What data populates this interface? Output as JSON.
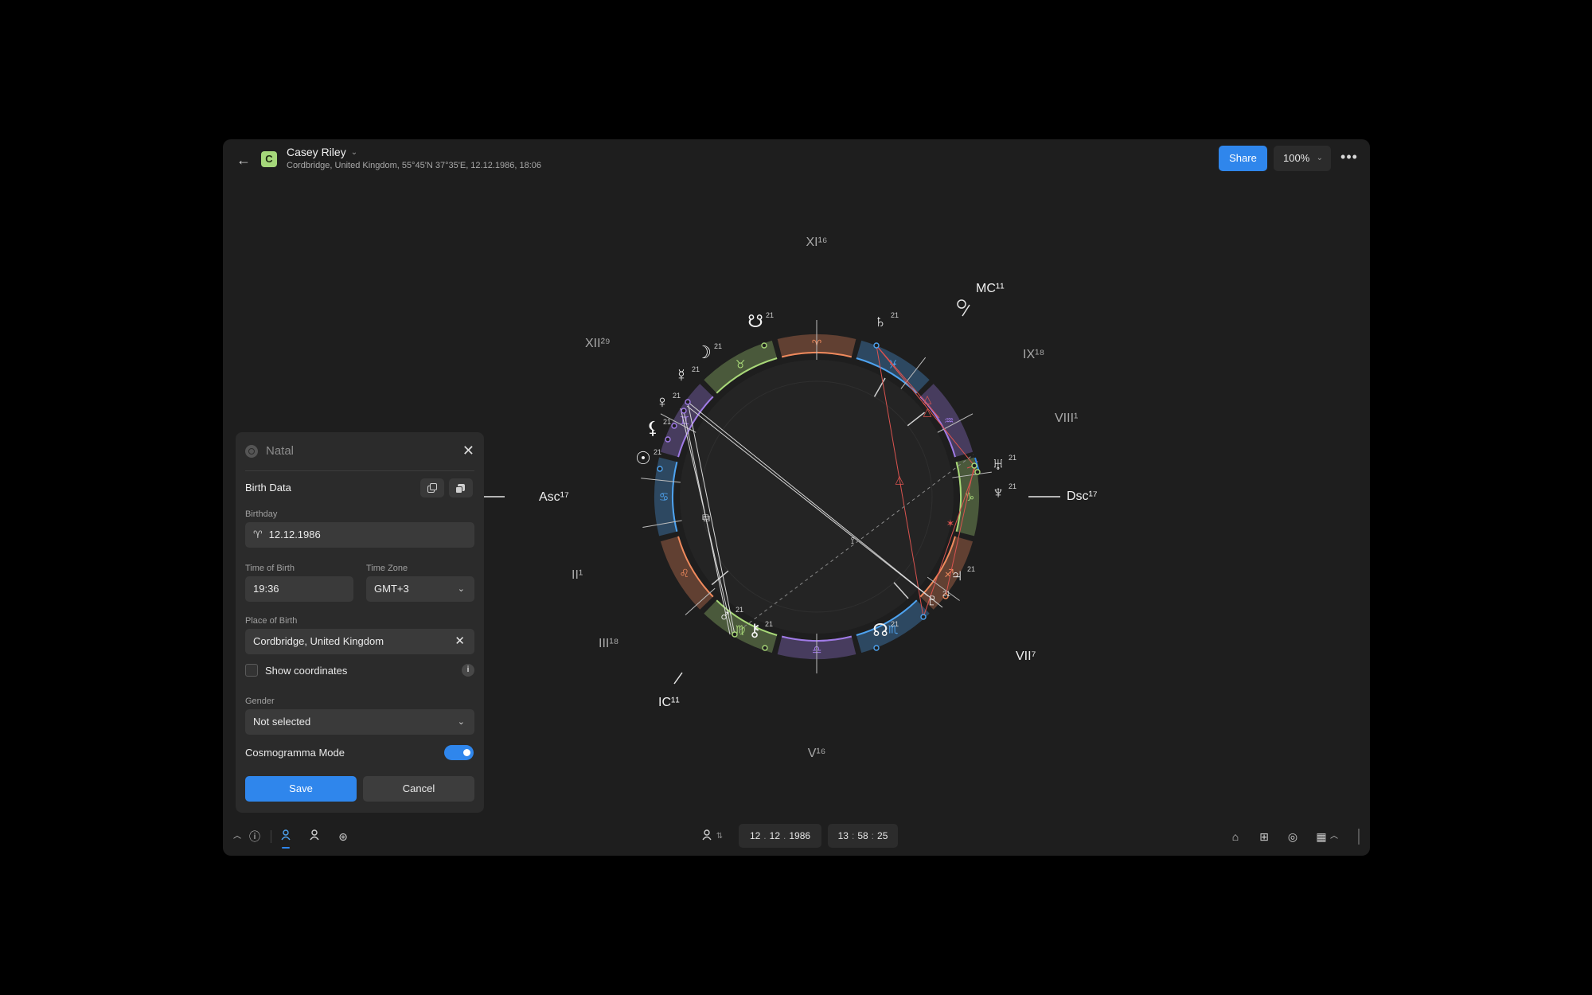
{
  "header": {
    "initial": "C",
    "name": "Casey Riley",
    "subtitle": "Cordbridge, United Kingdom, 55°45'N 37°35'E, 12.12.1986, 18:06",
    "share_label": "Share",
    "zoom_label": "100%"
  },
  "chart": {
    "outer_labels": {
      "xi": "XI¹⁶",
      "mc": "MC¹¹",
      "ix": "IX¹⁸",
      "viii": "VIII¹",
      "dsc": "Dsc¹⁷",
      "vii": "VII⁷",
      "v": "V¹⁶",
      "ic": "IC¹¹",
      "iii": "III¹⁸",
      "ii": "II¹",
      "asc": "Asc¹⁷",
      "xii": "XII²⁹"
    },
    "signs": [
      {
        "glyph": "♈",
        "color": "#f08a5d"
      },
      {
        "glyph": "♓",
        "color": "#4ea3f0"
      },
      {
        "glyph": "♒",
        "color": "#a07be6"
      },
      {
        "glyph": "♑",
        "color": "#a8d878"
      },
      {
        "glyph": "♐",
        "color": "#f08a5d"
      },
      {
        "glyph": "♏",
        "color": "#4ea3f0"
      },
      {
        "glyph": "♎",
        "color": "#a07be6"
      },
      {
        "glyph": "♍",
        "color": "#a8d878"
      },
      {
        "glyph": "♌",
        "color": "#f08a5d"
      },
      {
        "glyph": "♋",
        "color": "#4ea3f0"
      },
      {
        "glyph": "♊",
        "color": "#a07be6"
      },
      {
        "glyph": "♉",
        "color": "#a8d878"
      }
    ],
    "planets": [
      {
        "name": "saturn",
        "glyph": "♄",
        "deg": "21"
      },
      {
        "name": "south-node",
        "glyph": "☋",
        "deg": "21"
      },
      {
        "name": "moon",
        "glyph": "☽",
        "deg": "21"
      },
      {
        "name": "mercury",
        "glyph": "☿",
        "deg": "21"
      },
      {
        "name": "venus",
        "glyph": "♀",
        "deg": "21"
      },
      {
        "name": "lilith",
        "glyph": "⚸",
        "deg": "21"
      },
      {
        "name": "sun",
        "glyph": "☉",
        "deg": "21"
      },
      {
        "name": "mars",
        "glyph": "♂",
        "deg": "21"
      },
      {
        "name": "chiron",
        "glyph": "⚷",
        "deg": "21"
      },
      {
        "name": "north-node",
        "glyph": "☊",
        "deg": "21"
      },
      {
        "name": "pluto",
        "glyph": "♇",
        "deg": "21"
      },
      {
        "name": "jupiter",
        "glyph": "♃",
        "deg": "21"
      },
      {
        "name": "neptune",
        "glyph": "♆",
        "deg": "21"
      },
      {
        "name": "uranus",
        "glyph": "♅",
        "deg": "21"
      }
    ],
    "colors": {
      "ring_bg": "#262626",
      "aspect_red": "#d9534f",
      "aspect_white": "#d8d8d8",
      "accent": "#2f86ec"
    }
  },
  "panel": {
    "title": "Natal",
    "section": "Birth Data",
    "birthday_label": "Birthday",
    "birthday_sign": "♈",
    "birthday_value": "12.12.1986",
    "time_label": "Time of Birth",
    "time_value": "19:36",
    "tz_label": "Time Zone",
    "tz_value": "GMT+3",
    "place_label": "Place of Birth",
    "place_value": "Cordbridge, United Kingdom",
    "coords_label": "Show coordinates",
    "gender_label": "Gender",
    "gender_value": "Not selected",
    "cosmo_label": "Cosmogramma Mode",
    "cosmo_on": true,
    "save_label": "Save",
    "cancel_label": "Cancel"
  },
  "bottom": {
    "date": {
      "day": "12",
      "month": "12",
      "year": "1986"
    },
    "time": {
      "h": "13",
      "m": "58",
      "s": "25"
    }
  }
}
